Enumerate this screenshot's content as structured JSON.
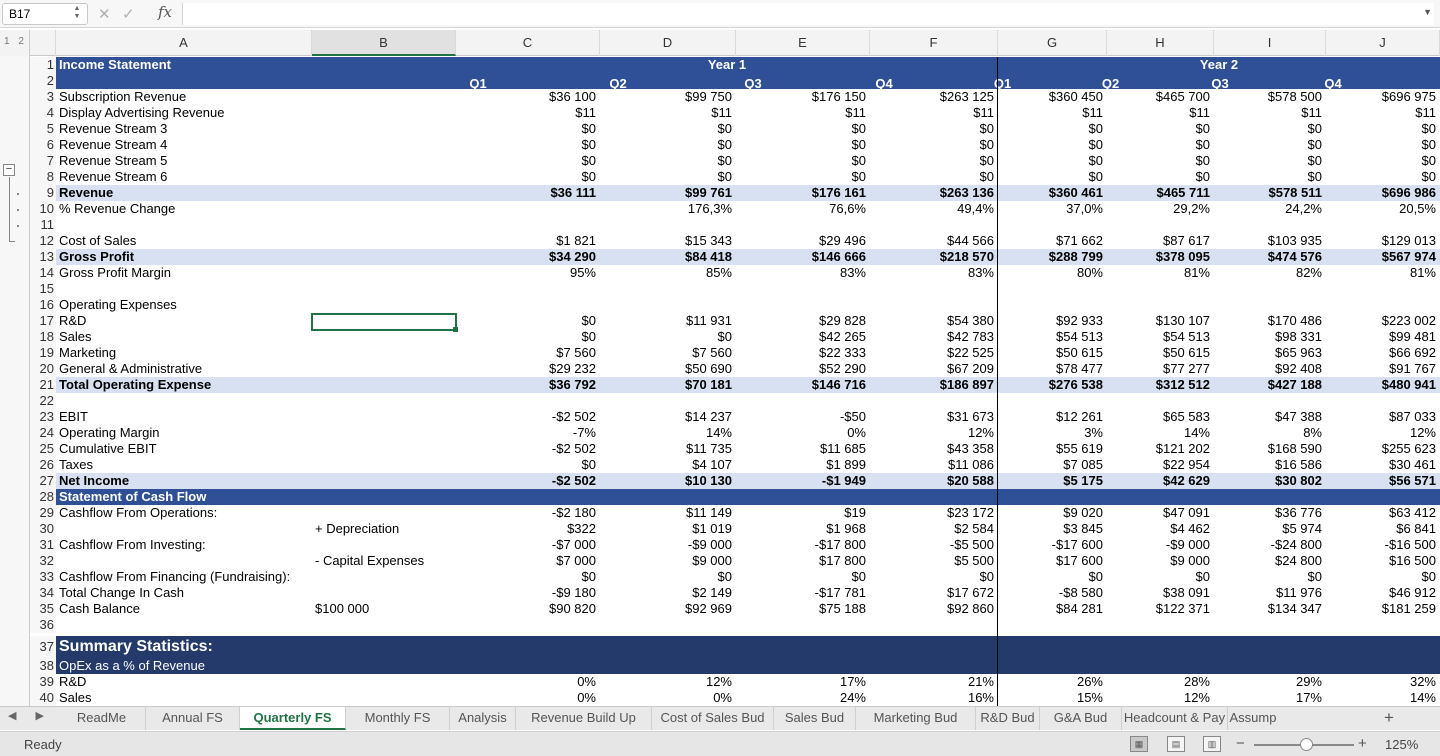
{
  "formula_bar": {
    "namebox": "B17",
    "fx_label": "fx",
    "formula": ""
  },
  "outline": {
    "levels": "1 2",
    "collapse": "−"
  },
  "columns": [
    {
      "id": "A",
      "label": "A"
    },
    {
      "id": "B",
      "label": "B"
    },
    {
      "id": "C",
      "label": "C"
    },
    {
      "id": "D",
      "label": "D"
    },
    {
      "id": "E",
      "label": "E"
    },
    {
      "id": "F",
      "label": "F"
    },
    {
      "id": "G",
      "label": "G"
    },
    {
      "id": "H",
      "label": "H"
    },
    {
      "id": "I",
      "label": "I"
    },
    {
      "id": "J",
      "label": "J"
    }
  ],
  "rows": [
    {
      "n": "1",
      "style": "hdr",
      "a": "Income Statement",
      "bold": true,
      "year1": "Year 1",
      "year2": "Year 2"
    },
    {
      "n": "2",
      "style": "hdr",
      "q": [
        "Q1",
        "Q2",
        "Q3",
        "Q4",
        "Q1",
        "Q2",
        "Q3",
        "Q4"
      ]
    },
    {
      "n": "3",
      "a": "Subscription Revenue",
      "v": [
        "$36 100",
        "$99 750",
        "$176 150",
        "$263 125",
        "$360 450",
        "$465 700",
        "$578 500",
        "$696 975"
      ]
    },
    {
      "n": "4",
      "a": "Display Advertising Revenue",
      "v": [
        "$11",
        "$11",
        "$11",
        "$11",
        "$11",
        "$11",
        "$11",
        "$11"
      ]
    },
    {
      "n": "5",
      "a": "Revenue Stream 3",
      "v": [
        "$0",
        "$0",
        "$0",
        "$0",
        "$0",
        "$0",
        "$0",
        "$0"
      ]
    },
    {
      "n": "6",
      "a": "Revenue Stream 4",
      "v": [
        "$0",
        "$0",
        "$0",
        "$0",
        "$0",
        "$0",
        "$0",
        "$0"
      ]
    },
    {
      "n": "7",
      "a": "Revenue Stream 5",
      "v": [
        "$0",
        "$0",
        "$0",
        "$0",
        "$0",
        "$0",
        "$0",
        "$0"
      ]
    },
    {
      "n": "8",
      "a": "Revenue Stream 6",
      "v": [
        "$0",
        "$0",
        "$0",
        "$0",
        "$0",
        "$0",
        "$0",
        "$0"
      ]
    },
    {
      "n": "9",
      "style": "band",
      "bold": true,
      "a": "Revenue",
      "v": [
        "$36 111",
        "$99 761",
        "$176 161",
        "$263 136",
        "$360 461",
        "$465 711",
        "$578 511",
        "$696 986"
      ]
    },
    {
      "n": "10",
      "a": "% Revenue Change",
      "v": [
        "",
        "176,3%",
        "76,6%",
        "49,4%",
        "37,0%",
        "29,2%",
        "24,2%",
        "20,5%"
      ]
    },
    {
      "n": "11"
    },
    {
      "n": "12",
      "a": "Cost of Sales",
      "v": [
        "$1 821",
        "$15 343",
        "$29 496",
        "$44 566",
        "$71 662",
        "$87 617",
        "$103 935",
        "$129 013"
      ]
    },
    {
      "n": "13",
      "style": "band",
      "bold": true,
      "a": "Gross Profit",
      "v": [
        "$34 290",
        "$84 418",
        "$146 666",
        "$218 570",
        "$288 799",
        "$378 095",
        "$474 576",
        "$567 974"
      ]
    },
    {
      "n": "14",
      "a": "Gross Profit Margin",
      "v": [
        "95%",
        "85%",
        "83%",
        "83%",
        "80%",
        "81%",
        "82%",
        "81%"
      ]
    },
    {
      "n": "15"
    },
    {
      "n": "16",
      "a": "Operating Expenses"
    },
    {
      "n": "17",
      "a": "R&D",
      "v": [
        "$0",
        "$11 931",
        "$29 828",
        "$54 380",
        "$92 933",
        "$130 107",
        "$170 486",
        "$223 002"
      ]
    },
    {
      "n": "18",
      "a": "Sales",
      "v": [
        "$0",
        "$0",
        "$42 265",
        "$42 783",
        "$54 513",
        "$54 513",
        "$98 331",
        "$99 481"
      ]
    },
    {
      "n": "19",
      "a": "Marketing",
      "v": [
        "$7 560",
        "$7 560",
        "$22 333",
        "$22 525",
        "$50 615",
        "$50 615",
        "$65 963",
        "$66 692"
      ]
    },
    {
      "n": "20",
      "a": "General & Administrative",
      "v": [
        "$29 232",
        "$50 690",
        "$52 290",
        "$67 209",
        "$78 477",
        "$77 277",
        "$92 408",
        "$91 767"
      ]
    },
    {
      "n": "21",
      "style": "band",
      "bold": true,
      "a": "Total Operating Expense",
      "v": [
        "$36 792",
        "$70 181",
        "$146 716",
        "$186 897",
        "$276 538",
        "$312 512",
        "$427 188",
        "$480 941"
      ]
    },
    {
      "n": "22"
    },
    {
      "n": "23",
      "a": "EBIT",
      "v": [
        "-$2 502",
        "$14 237",
        "-$50",
        "$31 673",
        "$12 261",
        "$65 583",
        "$47 388",
        "$87 033"
      ]
    },
    {
      "n": "24",
      "a": "Operating Margin",
      "v": [
        "-7%",
        "14%",
        "0%",
        "12%",
        "3%",
        "14%",
        "8%",
        "12%"
      ]
    },
    {
      "n": "25",
      "a": "Cumulative EBIT",
      "v": [
        "-$2 502",
        "$11 735",
        "$11 685",
        "$43 358",
        "$55 619",
        "$121 202",
        "$168 590",
        "$255 623"
      ]
    },
    {
      "n": "26",
      "a": "Taxes",
      "v": [
        "$0",
        "$4 107",
        "$1 899",
        "$11 086",
        "$7 085",
        "$22 954",
        "$16 586",
        "$30 461"
      ]
    },
    {
      "n": "27",
      "style": "band",
      "bold": true,
      "a": "Net Income",
      "v": [
        "-$2 502",
        "$10 130",
        "-$1 949",
        "$20 588",
        "$5 175",
        "$42 629",
        "$30 802",
        "$56 571"
      ]
    },
    {
      "n": "28",
      "style": "hdr",
      "bold": true,
      "a": "Statement of Cash Flow"
    },
    {
      "n": "29",
      "a": "Cashflow From Operations:",
      "v": [
        "-$2 180",
        "$11 149",
        "$19",
        "$23 172",
        "$9 020",
        "$47 091",
        "$36 776",
        "$63 412"
      ]
    },
    {
      "n": "30",
      "b": "+ Depreciation",
      "v": [
        "$322",
        "$1 019",
        "$1 968",
        "$2 584",
        "$3 845",
        "$4 462",
        "$5 974",
        "$6 841"
      ]
    },
    {
      "n": "31",
      "a": "Cashflow From Investing:",
      "v": [
        "-$7 000",
        "-$9 000",
        "-$17 800",
        "-$5 500",
        "-$17 600",
        "-$9 000",
        "-$24 800",
        "-$16 500"
      ]
    },
    {
      "n": "32",
      "b": "- Capital Expenses",
      "v": [
        "$7 000",
        "$9 000",
        "$17 800",
        "$5 500",
        "$17 600",
        "$9 000",
        "$24 800",
        "$16 500"
      ]
    },
    {
      "n": "33",
      "a": "Cashflow From Financing (Fundraising):",
      "v": [
        "$0",
        "$0",
        "$0",
        "$0",
        "$0",
        "$0",
        "$0",
        "$0"
      ]
    },
    {
      "n": "34",
      "a": "Total Change In Cash",
      "v": [
        "-$9 180",
        "$2 149",
        "-$17 781",
        "$17 672",
        "-$8 580",
        "$38 091",
        "$11 976",
        "$46 912"
      ]
    },
    {
      "n": "35",
      "a": "Cash Balance",
      "bval": "$100 000",
      "v": [
        "$90 820",
        "$92 969",
        "$75 188",
        "$92 860",
        "$84 281",
        "$122 371",
        "$134 347",
        "$181 259"
      ]
    },
    {
      "n": "36"
    },
    {
      "n": "37",
      "style": "hdr2",
      "bold": true,
      "big": true,
      "a": "Summary Statistics:"
    },
    {
      "n": "38",
      "style": "hdr2",
      "a": "OpEx as a % of Revenue"
    },
    {
      "n": "39",
      "a": "R&D",
      "v": [
        "0%",
        "12%",
        "17%",
        "21%",
        "26%",
        "28%",
        "29%",
        "32%"
      ]
    },
    {
      "n": "40",
      "a": "Sales",
      "v": [
        "0%",
        "0%",
        "24%",
        "16%",
        "15%",
        "12%",
        "17%",
        "14%"
      ]
    }
  ],
  "sheet_tabs": [
    "ReadMe",
    "Annual FS",
    "Quarterly FS",
    "Monthly FS",
    "Analysis",
    "Revenue Build Up",
    "Cost of Sales Bud",
    "Sales Bud",
    "Marketing Bud",
    "R&D Bud",
    "G&A Bud",
    "Headcount & Pay",
    "Assump"
  ],
  "active_tab": "Quarterly FS",
  "tab_nav": "◀ ▶",
  "add_sheet": "+",
  "status": {
    "ready": "Ready",
    "zoom": "125%",
    "minus": "−",
    "plus": "+"
  },
  "colors": {
    "header_blue": "#2f4f96",
    "dark_header": "#233a6b",
    "band": "#d7e1f2",
    "accent_green": "#217346"
  }
}
